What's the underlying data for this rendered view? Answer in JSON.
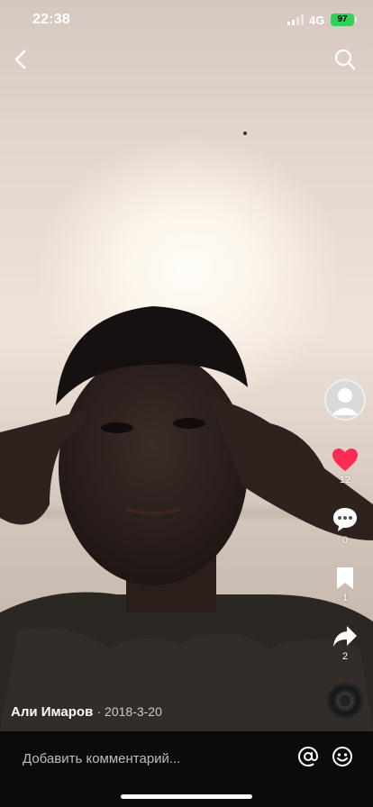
{
  "status_bar": {
    "time": "22:38",
    "network": "4G",
    "battery": "97"
  },
  "nav": {
    "back_icon": "chevron-left-icon",
    "search_icon": "search-icon"
  },
  "rail": {
    "likes": "12",
    "comments": "0",
    "bookmarks": "1",
    "shares": "2"
  },
  "video": {
    "author": "Али Имаров",
    "date": "· 2018-3-20"
  },
  "comment_bar": {
    "placeholder": "Добавить комментарий..."
  },
  "colors": {
    "like": "#fe2c55",
    "battery": "#30d158"
  }
}
